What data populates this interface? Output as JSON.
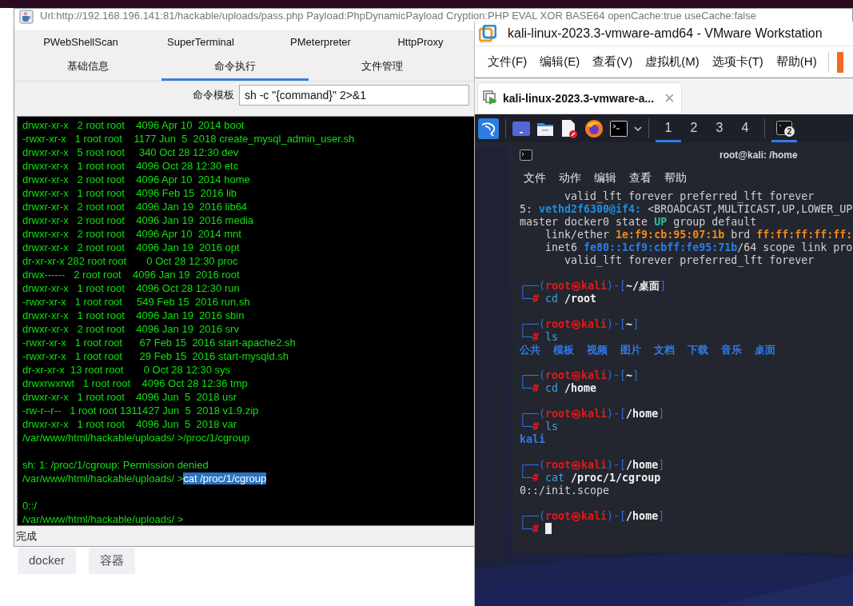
{
  "godzilla": {
    "title": "Url:http://192.168.196.141:81/hackable/uploads/pass.php Payload:PhpDynamicPayload Cryption:PHP EVAL XOR BASE64 openCache:true useCache:false",
    "plugin_tabs": [
      {
        "label": "PWebShellScan",
        "selected": false
      },
      {
        "label": "SuperTerminal",
        "selected": false
      },
      {
        "label": "PMeterpreter",
        "selected": false
      },
      {
        "label": "HttpProxy",
        "selected": false
      }
    ],
    "tabs": [
      {
        "label": "基础信息",
        "selected": false
      },
      {
        "label": "命令执行",
        "selected": true
      },
      {
        "label": "文件管理",
        "selected": false
      }
    ],
    "command_template": {
      "label": "命令模板",
      "value": "sh -c \"{command}\" 2>&1"
    },
    "console_lines": [
      {
        "text": "drwxr-xr-x   2 root root    4096 Apr 10  2014 boot"
      },
      {
        "text": "-rwxr-xr-x   1 root root    1177 Jun  5  2018 create_mysql_admin_user.sh"
      },
      {
        "text": "drwxr-xr-x   5 root root     340 Oct 28 12:30 dev"
      },
      {
        "text": "drwxr-xr-x   1 root root    4096 Oct 28 12:30 etc"
      },
      {
        "text": "drwxr-xr-x   2 root root    4096 Apr 10  2014 home"
      },
      {
        "text": "drwxr-xr-x   1 root root    4096 Feb 15  2016 lib"
      },
      {
        "text": "drwxr-xr-x   2 root root    4096 Jan 19  2016 lib64"
      },
      {
        "text": "drwxr-xr-x   2 root root    4096 Jan 19  2016 media"
      },
      {
        "text": "drwxr-xr-x   2 root root    4096 Apr 10  2014 mnt"
      },
      {
        "text": "drwxr-xr-x   2 root root    4096 Jan 19  2016 opt"
      },
      {
        "text": "dr-xr-xr-x 282 root root       0 Oct 28 12:30 proc"
      },
      {
        "text": "drwx------   2 root root    4096 Jan 19  2016 root"
      },
      {
        "text": "drwxr-xr-x   1 root root    4096 Oct 28 12:30 run"
      },
      {
        "text": "-rwxr-xr-x   1 root root     549 Feb 15  2016 run.sh"
      },
      {
        "text": "drwxr-xr-x   1 root root    4096 Jan 19  2016 sbin"
      },
      {
        "text": "drwxr-xr-x   2 root root    4096 Jan 19  2016 srv"
      },
      {
        "text": "-rwxr-xr-x   1 root root      67 Feb 15  2016 start-apache2.sh"
      },
      {
        "text": "-rwxr-xr-x   1 root root      29 Feb 15  2016 start-mysqld.sh"
      },
      {
        "text": "dr-xr-xr-x  13 root root       0 Oct 28 12:30 sys"
      },
      {
        "text": "drwxrwxrwt   1 root root    4096 Oct 28 12:36 tmp"
      },
      {
        "text": "drwxr-xr-x   1 root root    4096 Jun  5  2018 usr"
      },
      {
        "text": "-rw-r--r--   1 root root 1311427 Jun  5  2018 v1.9.zip"
      },
      {
        "text": "drwxr-xr-x   1 root root    4096 Jun  5  2018 var"
      },
      {
        "text": "/var/www/html/hackable/uploads/ >/proc/1/cgroup"
      },
      {
        "text": "sh: 1: /proc/1/cgroup: Permission denied",
        "blank_before": true
      },
      {
        "segments": [
          {
            "text": "/var/www/html/hackable/uploads/ >",
            "selected": false
          },
          {
            "text": "cat /proc/1/cgroup",
            "selected": true
          }
        ]
      },
      {
        "text": "0::/",
        "blank_before": true
      },
      {
        "text": "/var/www/html/hackable/uploads/ >"
      }
    ],
    "status": "完成"
  },
  "tags": [
    "docker",
    "容器"
  ],
  "vmware": {
    "title": "kali-linux-2023.3-vmware-amd64 - VMware Workstation",
    "menu": [
      "文件(F)",
      "编辑(E)",
      "查看(V)",
      "虚拟机(M)",
      "选项卡(T)",
      "帮助(H)"
    ],
    "tab": {
      "label": "kali-linux-2023.3-vmware-a...",
      "selected": true,
      "close": "×"
    },
    "workspaces": [
      {
        "label": "1",
        "selected": true
      },
      {
        "label": "2",
        "selected": false
      },
      {
        "label": "3",
        "selected": false
      },
      {
        "label": "4",
        "selected": false
      }
    ],
    "window_button": {
      "badge": "2",
      "selected": true
    },
    "terminal": {
      "title": "root@kali: /home",
      "menu": [
        "文件",
        "动作",
        "编辑",
        "查看",
        "帮助"
      ],
      "lines": [
        {
          "segments": [
            {
              "text": "       valid_lft forever preferred_lft forever",
              "kind": "plain"
            }
          ]
        },
        {
          "segments": [
            {
              "text": "5: ",
              "kind": "plain"
            },
            {
              "text": "vethd2f6300@if4:",
              "kind": "iface"
            },
            {
              "text": " <BROADCAST,MULTICAST,UP,LOWER_UP",
              "kind": "plain"
            }
          ]
        },
        {
          "segments": [
            {
              "text": "master docker0 state ",
              "kind": "plain"
            },
            {
              "text": "UP",
              "kind": "state"
            },
            {
              "text": " group default",
              "kind": "plain"
            }
          ]
        },
        {
          "segments": [
            {
              "text": "    link/ether ",
              "kind": "plain"
            },
            {
              "text": "1e:f9:cb:95:07:1b",
              "kind": "mac"
            },
            {
              "text": " brd ",
              "kind": "plain"
            },
            {
              "text": "ff:ff:ff:ff:ff:",
              "kind": "mac"
            }
          ]
        },
        {
          "segments": [
            {
              "text": "    inet6 ",
              "kind": "plain"
            },
            {
              "text": "fe80::1cf9:cbff:fe95:71b",
              "kind": "addr"
            },
            {
              "text": "/64 scope link pro",
              "kind": "plain"
            }
          ]
        },
        {
          "segments": [
            {
              "text": "       valid_lft forever preferred_lft forever",
              "kind": "plain"
            }
          ]
        },
        {
          "blank_before": true,
          "segments": [
            {
              "text": "┌──(",
              "kind": "frame"
            },
            {
              "text": "root㉿kali",
              "kind": "user"
            },
            {
              "text": ")-[",
              "kind": "frame"
            },
            {
              "text": "~/桌面",
              "kind": "path"
            },
            {
              "text": "]",
              "kind": "frame"
            }
          ]
        },
        {
          "segments": [
            {
              "text": "└─",
              "kind": "frame"
            },
            {
              "text": "#",
              "kind": "hash"
            },
            {
              "text": " cd",
              "kind": "cmd"
            },
            {
              "text": " /root",
              "kind": "arg"
            }
          ]
        },
        {
          "blank_before": true,
          "segments": [
            {
              "text": "┌──(",
              "kind": "frame"
            },
            {
              "text": "root㉿kali",
              "kind": "user"
            },
            {
              "text": ")-[",
              "kind": "frame"
            },
            {
              "text": "~",
              "kind": "path"
            },
            {
              "text": "]",
              "kind": "frame"
            }
          ]
        },
        {
          "segments": [
            {
              "text": "└─",
              "kind": "frame"
            },
            {
              "text": "#",
              "kind": "hash"
            },
            {
              "text": " ls",
              "kind": "cmd"
            }
          ]
        },
        {
          "segments": [
            {
              "text": "公共  模板  视频  图片  文档  下载  音乐  桌面",
              "kind": "dir"
            }
          ]
        },
        {
          "blank_before": true,
          "segments": [
            {
              "text": "┌──(",
              "kind": "frame"
            },
            {
              "text": "root㉿kali",
              "kind": "user"
            },
            {
              "text": ")-[",
              "kind": "frame"
            },
            {
              "text": "~",
              "kind": "path"
            },
            {
              "text": "]",
              "kind": "frame"
            }
          ]
        },
        {
          "segments": [
            {
              "text": "└─",
              "kind": "frame"
            },
            {
              "text": "#",
              "kind": "hash"
            },
            {
              "text": " cd",
              "kind": "cmd"
            },
            {
              "text": " /home",
              "kind": "arg"
            }
          ]
        },
        {
          "blank_before": true,
          "segments": [
            {
              "text": "┌──(",
              "kind": "frame"
            },
            {
              "text": "root㉿kali",
              "kind": "user"
            },
            {
              "text": ")-[",
              "kind": "frame"
            },
            {
              "text": "/home",
              "kind": "path"
            },
            {
              "text": "]",
              "kind": "frame"
            }
          ]
        },
        {
          "segments": [
            {
              "text": "└─",
              "kind": "frame"
            },
            {
              "text": "#",
              "kind": "hash"
            },
            {
              "text": " ls",
              "kind": "cmd"
            }
          ]
        },
        {
          "segments": [
            {
              "text": "kali",
              "kind": "dir"
            }
          ]
        },
        {
          "blank_before": true,
          "segments": [
            {
              "text": "┌──(",
              "kind": "frame"
            },
            {
              "text": "root㉿kali",
              "kind": "user"
            },
            {
              "text": ")-[",
              "kind": "frame"
            },
            {
              "text": "/home",
              "kind": "path"
            },
            {
              "text": "]",
              "kind": "frame"
            }
          ]
        },
        {
          "segments": [
            {
              "text": "└─",
              "kind": "frame"
            },
            {
              "text": "#",
              "kind": "hash"
            },
            {
              "text": " cat",
              "kind": "cmd"
            },
            {
              "text": " /proc/1/cgroup",
              "kind": "arg"
            }
          ]
        },
        {
          "segments": [
            {
              "text": "0::/init.scope",
              "kind": "plain"
            }
          ]
        },
        {
          "blank_before": true,
          "segments": [
            {
              "text": "┌──(",
              "kind": "frame"
            },
            {
              "text": "root㉿kali",
              "kind": "user"
            },
            {
              "text": ")-[",
              "kind": "frame"
            },
            {
              "text": "/home",
              "kind": "path"
            },
            {
              "text": "]",
              "kind": "frame"
            }
          ]
        },
        {
          "cursor": true,
          "segments": [
            {
              "text": "└─",
              "kind": "frame"
            },
            {
              "text": "#",
              "kind": "hash"
            }
          ]
        }
      ]
    }
  }
}
